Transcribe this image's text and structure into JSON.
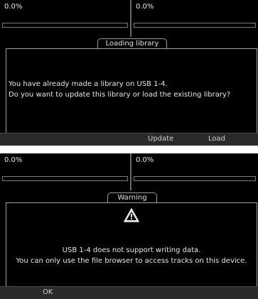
{
  "screen1": {
    "deck_left_pct": "0.0%",
    "deck_right_pct": "0.0%",
    "dialog_title": "Loading library",
    "message_line1": "You have already made a library on USB 1-4.",
    "message_line2": "Do you want to update this library or load the existing library?",
    "buttons": {
      "update": "Update",
      "load": "Load"
    }
  },
  "screen2": {
    "deck_left_pct": "0.0%",
    "deck_right_pct": "0.0%",
    "dialog_title": "Warning",
    "icon": "warning-icon",
    "message_line1": "USB 1-4  does not support writing data.",
    "message_line2": "You can only use the file browser to access tracks on this device.",
    "buttons": {
      "ok": "OK"
    }
  }
}
